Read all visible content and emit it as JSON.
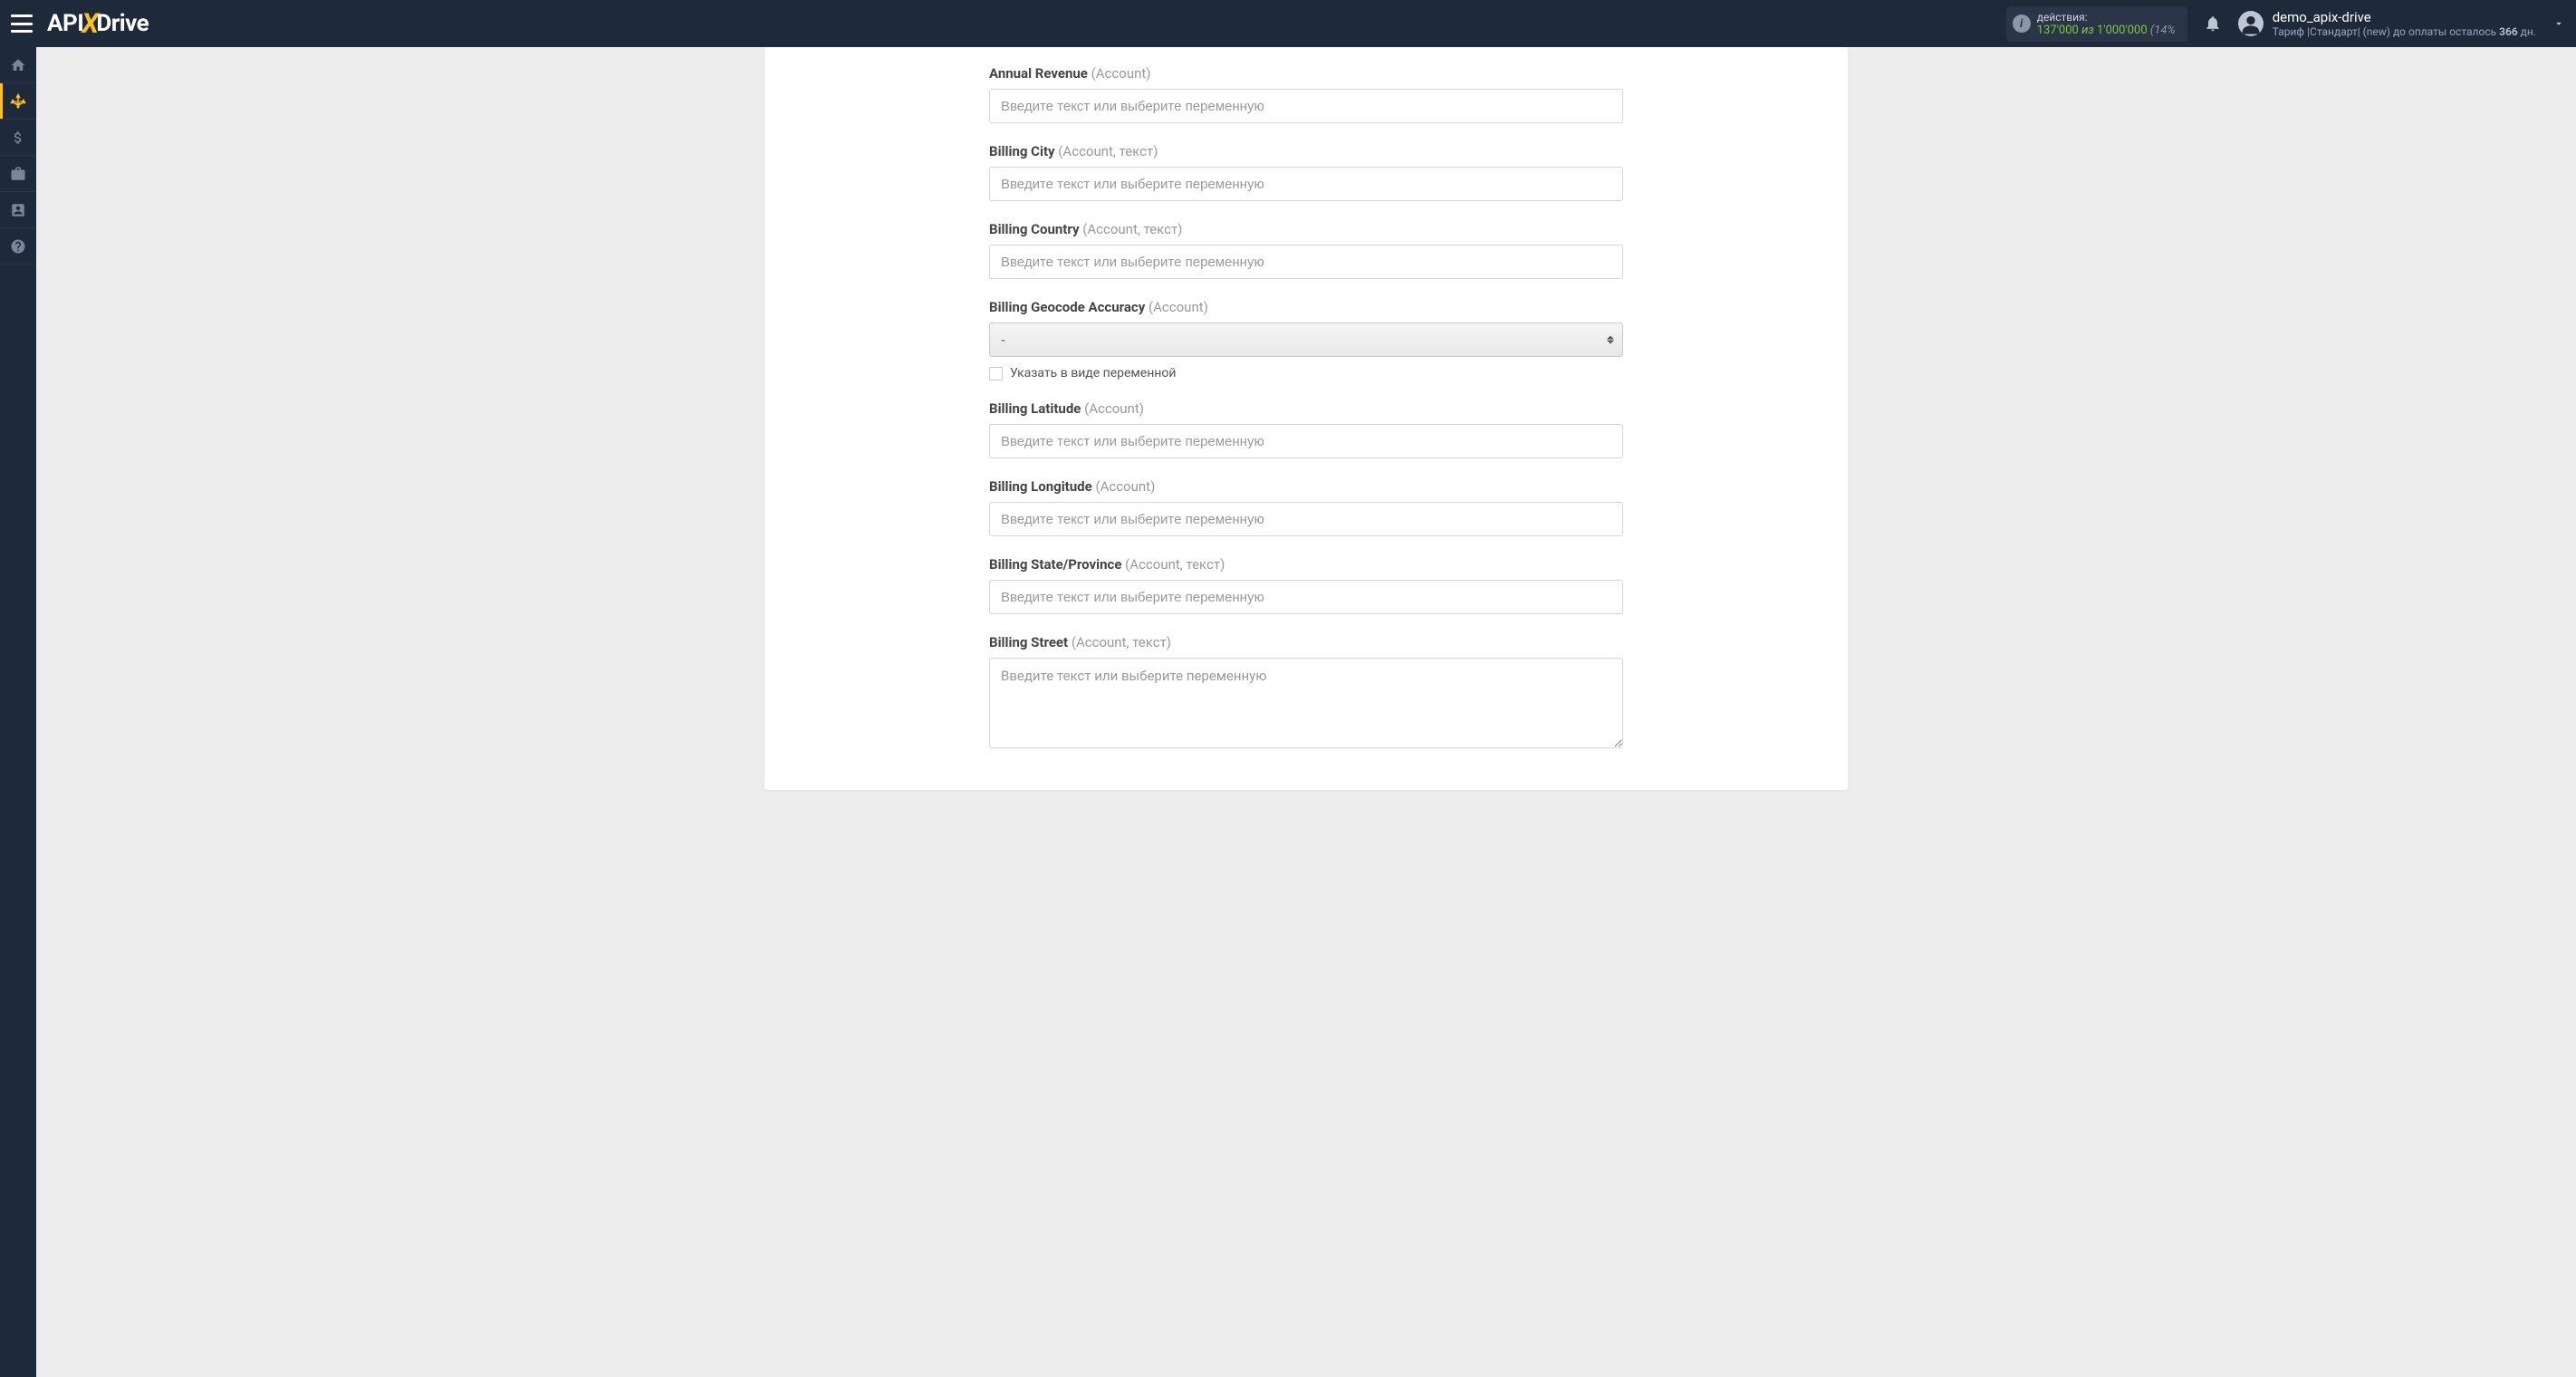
{
  "header": {
    "logo": {
      "part1": "API",
      "part2": "X",
      "part3": "Drive"
    },
    "actions": {
      "label": "действия:",
      "used": "137'000",
      "of": "из",
      "total": "1'000'000",
      "pct": "(14%"
    },
    "user": {
      "name": "demo_apix-drive",
      "tariff_prefix": "Тариф |Стандарт| (new) до оплаты осталось",
      "days": "366",
      "days_suffix": "дн."
    }
  },
  "form": {
    "placeholder": "Введите текст или выберите переменную",
    "variable_checkbox_label": "Указать в виде переменной",
    "fields": [
      {
        "id": "annual-revenue",
        "label": "Annual Revenue",
        "hint": "(Account)",
        "type": "text"
      },
      {
        "id": "billing-city",
        "label": "Billing City",
        "hint": "(Account, текст)",
        "type": "text"
      },
      {
        "id": "billing-country",
        "label": "Billing Country",
        "hint": "(Account, текст)",
        "type": "text"
      },
      {
        "id": "billing-geocode-accuracy",
        "label": "Billing Geocode Accuracy",
        "hint": "(Account)",
        "type": "select",
        "value": "-"
      },
      {
        "id": "billing-latitude",
        "label": "Billing Latitude",
        "hint": "(Account)",
        "type": "text"
      },
      {
        "id": "billing-longitude",
        "label": "Billing Longitude",
        "hint": "(Account)",
        "type": "text"
      },
      {
        "id": "billing-state",
        "label": "Billing State/Province",
        "hint": "(Account, текст)",
        "type": "text"
      },
      {
        "id": "billing-street",
        "label": "Billing Street",
        "hint": "(Account, текст)",
        "type": "textarea"
      }
    ]
  }
}
